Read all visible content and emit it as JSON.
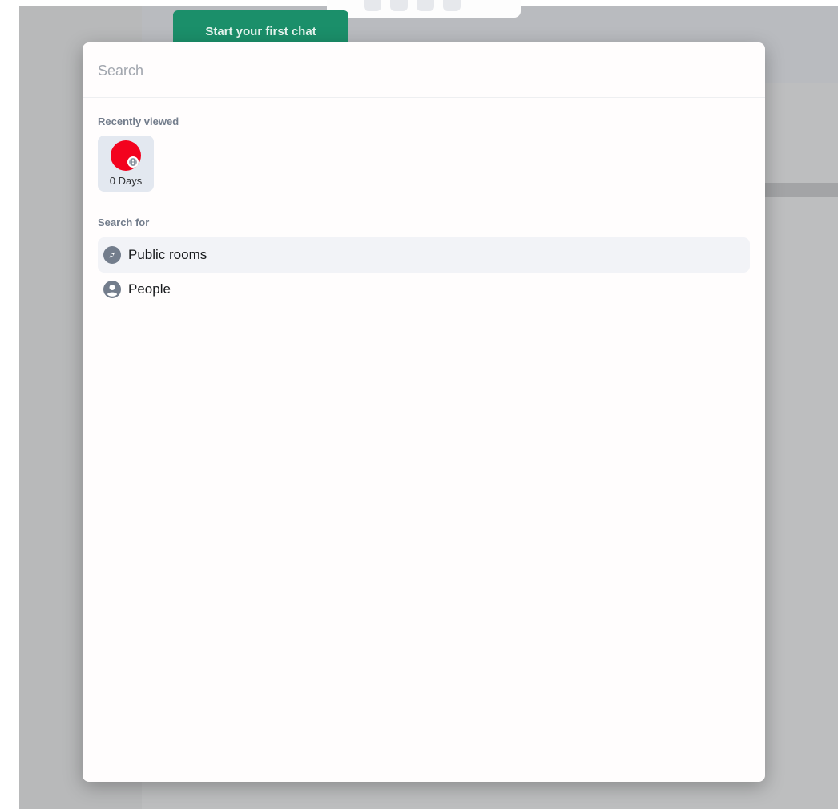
{
  "background": {
    "start_chat_label": "Start your first chat"
  },
  "search": {
    "value": "",
    "placeholder": "Search"
  },
  "recently_viewed": {
    "heading": "Recently viewed",
    "items": [
      {
        "name": "0 Days",
        "avatar_color": "#f3021e",
        "icon": "globe-icon"
      }
    ]
  },
  "search_for": {
    "heading": "Search for",
    "options": [
      {
        "label": "Public rooms",
        "icon": "compass-icon",
        "selected": true
      },
      {
        "label": "People",
        "icon": "user-circle-icon",
        "selected": false
      }
    ]
  },
  "colors": {
    "accent_green": "#1b8f6a",
    "muted_text": "#737d8c",
    "highlight_row": "#f2f3f7"
  }
}
